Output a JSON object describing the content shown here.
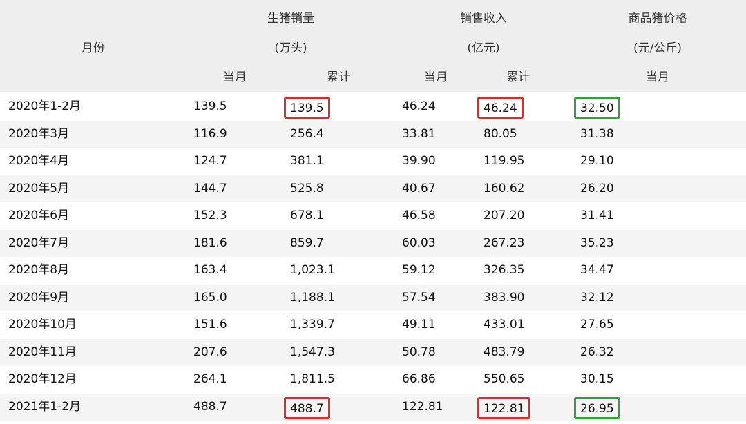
{
  "header": {
    "month": "月份",
    "sales_volume": "生猪销量",
    "sales_volume_unit": "(万头)",
    "revenue": "销售收入",
    "revenue_unit": "(亿元)",
    "price": "商品猪价格",
    "price_unit": "(元/公斤)",
    "current": "当月",
    "cumulative": "累计"
  },
  "rows": [
    {
      "month": "2020年1-2月",
      "vol_cur": "139.5",
      "vol_cum": "139.5",
      "rev_cur": "46.24",
      "rev_cum": "46.24",
      "price": "32.50"
    },
    {
      "month": "2020年3月",
      "vol_cur": "116.9",
      "vol_cum": "256.4",
      "rev_cur": "33.81",
      "rev_cum": "80.05",
      "price": "31.38"
    },
    {
      "month": "2020年4月",
      "vol_cur": "124.7",
      "vol_cum": "381.1",
      "rev_cur": "39.90",
      "rev_cum": "119.95",
      "price": "29.10"
    },
    {
      "month": "2020年5月",
      "vol_cur": "144.7",
      "vol_cum": "525.8",
      "rev_cur": "40.67",
      "rev_cum": "160.62",
      "price": "26.20"
    },
    {
      "month": "2020年6月",
      "vol_cur": "152.3",
      "vol_cum": "678.1",
      "rev_cur": "46.58",
      "rev_cum": "207.20",
      "price": "31.41"
    },
    {
      "month": "2020年7月",
      "vol_cur": "181.6",
      "vol_cum": "859.7",
      "rev_cur": "60.03",
      "rev_cum": "267.23",
      "price": "35.23"
    },
    {
      "month": "2020年8月",
      "vol_cur": "163.4",
      "vol_cum": "1,023.1",
      "rev_cur": "59.12",
      "rev_cum": "326.35",
      "price": "34.47"
    },
    {
      "month": "2020年9月",
      "vol_cur": "165.0",
      "vol_cum": "1,188.1",
      "rev_cur": "57.54",
      "rev_cum": "383.90",
      "price": "32.12"
    },
    {
      "month": "2020年10月",
      "vol_cur": "151.6",
      "vol_cum": "1,339.7",
      "rev_cur": "49.11",
      "rev_cum": "433.01",
      "price": "27.65"
    },
    {
      "month": "2020年11月",
      "vol_cur": "207.6",
      "vol_cum": "1,547.3",
      "rev_cur": "50.78",
      "rev_cum": "483.79",
      "price": "26.32"
    },
    {
      "month": "2020年12月",
      "vol_cur": "264.1",
      "vol_cum": "1,811.5",
      "rev_cur": "66.86",
      "rev_cum": "550.65",
      "price": "30.15"
    },
    {
      "month": "2021年1-2月",
      "vol_cur": "488.7",
      "vol_cum": "488.7",
      "rev_cur": "122.81",
      "rev_cum": "122.81",
      "price": "26.95"
    }
  ],
  "colors": {
    "highlight_red": "#e8262a",
    "highlight_green": "#2aa33a",
    "header_bg": "#eeeeee",
    "row_alt_bg": "#f4f4f4"
  }
}
